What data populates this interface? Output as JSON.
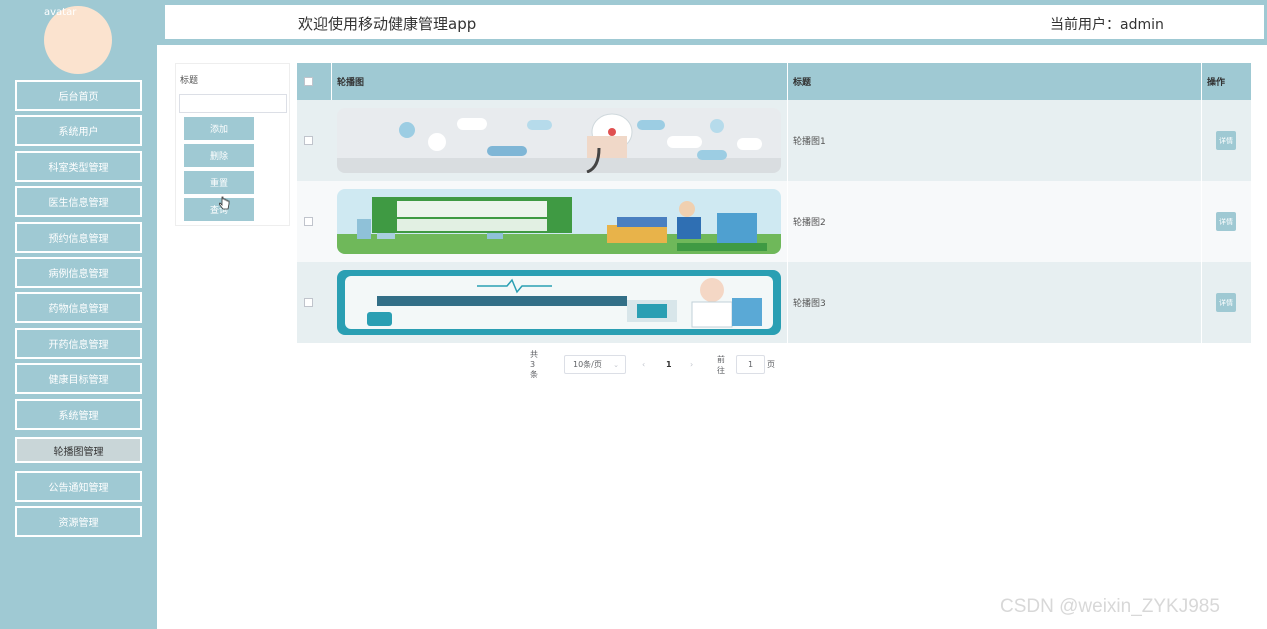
{
  "sidebar": {
    "avatar_alt": "avatar",
    "items": [
      {
        "label": "后台首页"
      },
      {
        "label": "系统用户"
      },
      {
        "label": "科室类型管理"
      },
      {
        "label": "医生信息管理"
      },
      {
        "label": "预约信息管理"
      },
      {
        "label": "病例信息管理"
      },
      {
        "label": "药物信息管理"
      },
      {
        "label": "开药信息管理"
      },
      {
        "label": "健康目标管理"
      },
      {
        "label": "系统管理"
      },
      {
        "label": "轮播图管理"
      },
      {
        "label": "公告通知管理"
      },
      {
        "label": "资源管理"
      }
    ],
    "active_index": 10
  },
  "header": {
    "title": "欢迎使用移动健康管理app",
    "user": "当前用户：admin"
  },
  "search": {
    "label": "标题",
    "value": "",
    "placeholder": "",
    "add_label": "添加",
    "delete_label": "删除",
    "reset_label": "重置",
    "query_label": "查询"
  },
  "table": {
    "columns": [
      "轮播图",
      "标题",
      "操作"
    ],
    "rows": [
      {
        "image_icon": "health-banner-1",
        "title": "轮播图1",
        "action": "详情"
      },
      {
        "image_icon": "health-banner-2",
        "title": "轮播图2",
        "action": "详情"
      },
      {
        "image_icon": "health-banner-3",
        "title": "轮播图3",
        "action": "详情"
      }
    ]
  },
  "pagination": {
    "total": "共 3 条",
    "page_size": "10条/页",
    "current_page": "1",
    "goto_label": "前往",
    "goto_value": "1",
    "page_unit": "页"
  },
  "watermark": "CSDN @weixin_ZYKJ985",
  "colors": {
    "accent": "#9fc9d3",
    "avatar": "#fbe3cf",
    "active_menu": "#c9d6d8"
  }
}
